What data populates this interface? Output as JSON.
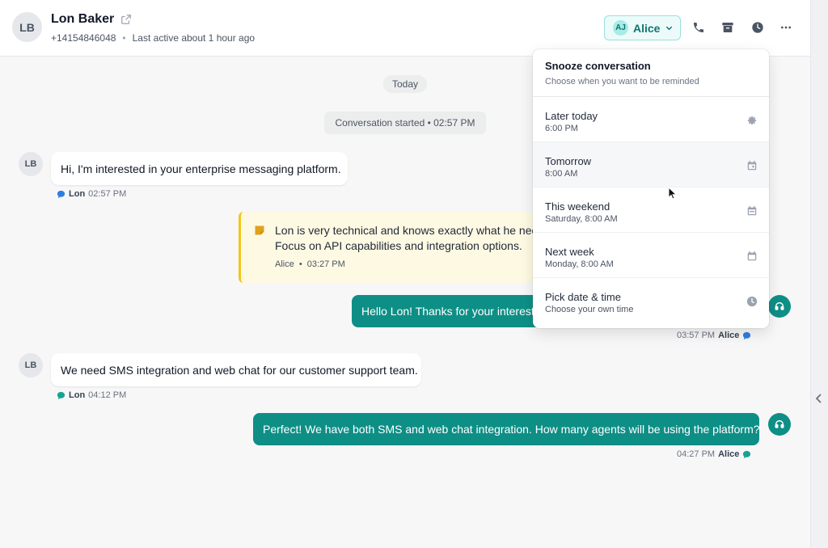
{
  "contact": {
    "initials": "LB",
    "name": "Lon Baker",
    "phone": "+14154846048",
    "separator": "•",
    "last_active": "Last active about 1 hour ago"
  },
  "header": {
    "assignee_initials": "AJ",
    "assignee_name": "Alice",
    "icons": [
      "phone-icon",
      "archive-icon",
      "clock-icon",
      "more-icon"
    ]
  },
  "timeline": {
    "day_label": "Today",
    "started_label": "Conversation started • 02:57 PM"
  },
  "messages": [
    {
      "direction": "in",
      "avatar": "LB",
      "text": "Hi, I'm interested in your enterprise messaging platform.",
      "sender": "Lon",
      "time": "02:57 PM"
    },
    {
      "direction": "out",
      "text": "Hello Lon! Thanks for your interest",
      "time": "03:57 PM",
      "sender": "Alice"
    },
    {
      "direction": "in",
      "avatar": "LB",
      "text": "We need SMS integration and web chat for our customer support team.",
      "sender": "Lon",
      "time": "04:12 PM"
    },
    {
      "direction": "out",
      "text": "Perfect! We have both SMS and web chat integration. How many agents will be using the platform?",
      "time": "04:27 PM",
      "sender": "Alice"
    }
  ],
  "note": {
    "line1": "Lon is very technical and knows exactly what he nee",
    "line2": "Focus on API capabilities and integration options.",
    "author": "Alice",
    "separator": "•",
    "time": "03:27 PM"
  },
  "snooze": {
    "title": "Snooze conversation",
    "subtitle": "Choose when you want to be reminded",
    "options": [
      {
        "label": "Later today",
        "time": "6:00 PM",
        "icon": "gear-icon"
      },
      {
        "label": "Tomorrow",
        "time": "8:00 AM",
        "icon": "calendar-icon"
      },
      {
        "label": "This weekend",
        "time": "Saturday, 8:00 AM",
        "icon": "calendar-icon"
      },
      {
        "label": "Next week",
        "time": "Monday, 8:00 AM",
        "icon": "calendar-icon"
      },
      {
        "label": "Pick date & time",
        "time": "Choose your own time",
        "icon": "clock-icon"
      }
    ]
  },
  "colors": {
    "brand": "#0e8f86",
    "note_bg": "#fef9e3",
    "note_border": "#f5c518"
  }
}
